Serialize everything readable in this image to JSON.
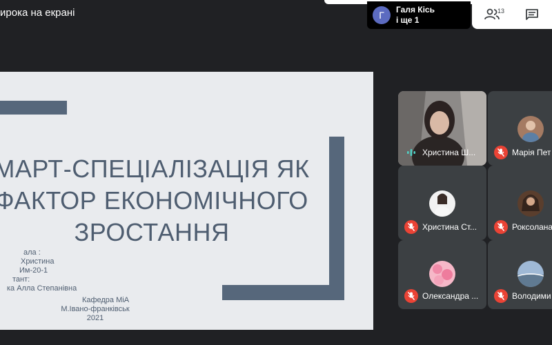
{
  "presentation_banner": {
    "title": "ирока на екрані"
  },
  "presenter": {
    "avatar_letter": "Г",
    "name": "Галя Кісь",
    "others": "і ще 1"
  },
  "controls": {
    "people_count": "13",
    "people_icon": "people-icon",
    "chat_icon": "chat-icon"
  },
  "slide": {
    "title_lines": [
      "МАРТ-СПЕЦІАЛІЗАЦІЯ ЯК",
      "ФАКТОР ЕКОНОМІЧНОГО",
      "ЗРОСТАННЯ"
    ],
    "info_lines": [
      "ала :",
      "Христина",
      "Им-20-1",
      "тант:",
      "ка Алла Степанівна"
    ],
    "department": "Кафедра МіА",
    "city": "М.Івано-франківськ",
    "year": "2021"
  },
  "participants": [
    {
      "name": "Христина Ш...",
      "mic": "speaking",
      "video": true
    },
    {
      "name": "Марія Пет",
      "mic": "muted"
    },
    {
      "name": "Христина Ст...",
      "mic": "muted"
    },
    {
      "name": "Роксолана",
      "mic": "muted"
    },
    {
      "name": "Олександра ...",
      "mic": "muted"
    },
    {
      "name": "Володими",
      "mic": "muted"
    }
  ],
  "colors": {
    "background": "#202124",
    "tile": "#3c4043",
    "slide_bg": "#e9ebee",
    "slide_accent": "#56677b",
    "mute": "#ea4335",
    "speaking": "#4fd1c5"
  }
}
